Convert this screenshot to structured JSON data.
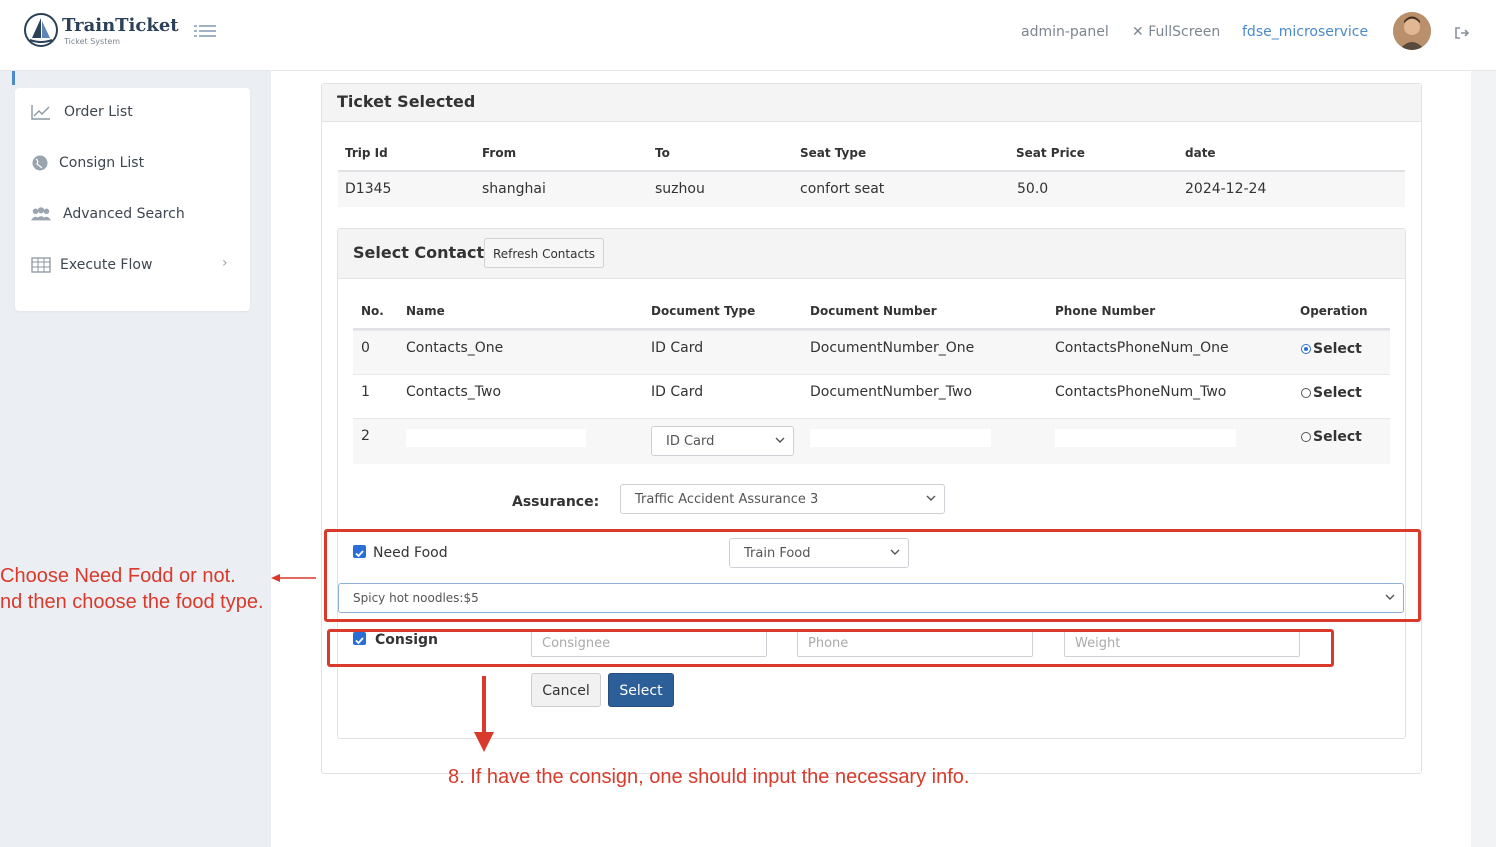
{
  "header": {
    "brand": "TrainTicket",
    "brand_subtitle": "Ticket System",
    "links": {
      "admin": "admin-panel",
      "fullscreen": "FullScreen",
      "project": "fdse_microservice"
    }
  },
  "sidebar": {
    "items": [
      {
        "label": "Order List",
        "icon": "line-chart-icon"
      },
      {
        "label": "Consign List",
        "icon": "globe-icon"
      },
      {
        "label": "Advanced Search",
        "icon": "users-icon"
      },
      {
        "label": "Execute Flow",
        "icon": "table-icon",
        "chevron": "›"
      }
    ]
  },
  "ticket": {
    "title": "Ticket Selected",
    "columns": [
      "Trip Id",
      "From",
      "To",
      "Seat Type",
      "Seat Price",
      "date"
    ],
    "row": [
      "D1345",
      "shanghai",
      "suzhou",
      "confort seat",
      "50.0",
      "2024-12-24"
    ]
  },
  "contacts": {
    "title": "Select Contacts",
    "refresh_label": "Refresh Contacts",
    "columns": [
      "No.",
      "Name",
      "Document Type",
      "Document Number",
      "Phone Number",
      "Operation"
    ],
    "rows": [
      {
        "no": "0",
        "name": "Contacts_One",
        "doc_type": "ID Card",
        "doc_number": "DocumentNumber_One",
        "phone": "ContactsPhoneNum_One",
        "op": "Select",
        "selected": true
      },
      {
        "no": "1",
        "name": "Contacts_Two",
        "doc_type": "ID Card",
        "doc_number": "DocumentNumber_Two",
        "phone": "ContactsPhoneNum_Two",
        "op": "Select",
        "selected": false
      },
      {
        "no": "2",
        "name": "",
        "doc_type": "ID Card",
        "doc_number": "",
        "phone": "",
        "op": "Select",
        "selected": false
      }
    ]
  },
  "form": {
    "assurance_label": "Assurance:",
    "assurance_value": "Traffic Accident Assurance 3",
    "need_food_label": "Need Food",
    "food_type": "Train Food",
    "food_item": "Spicy hot noodles:$5",
    "consign_label": "Consign",
    "consignee_placeholder": "Consignee",
    "phone_placeholder": "Phone",
    "weight_placeholder": "Weight",
    "cancel_label": "Cancel",
    "select_label": "Select"
  },
  "annotations": {
    "food_line1": "Choose Need Fodd or not.",
    "food_line2": "nd then choose the food type.",
    "consign_note": "8. If have the consign, one should input the necessary info."
  },
  "colors": {
    "accent": "#2c5f97",
    "annotation": "#d93a2b",
    "link": "#4a8ac8"
  }
}
